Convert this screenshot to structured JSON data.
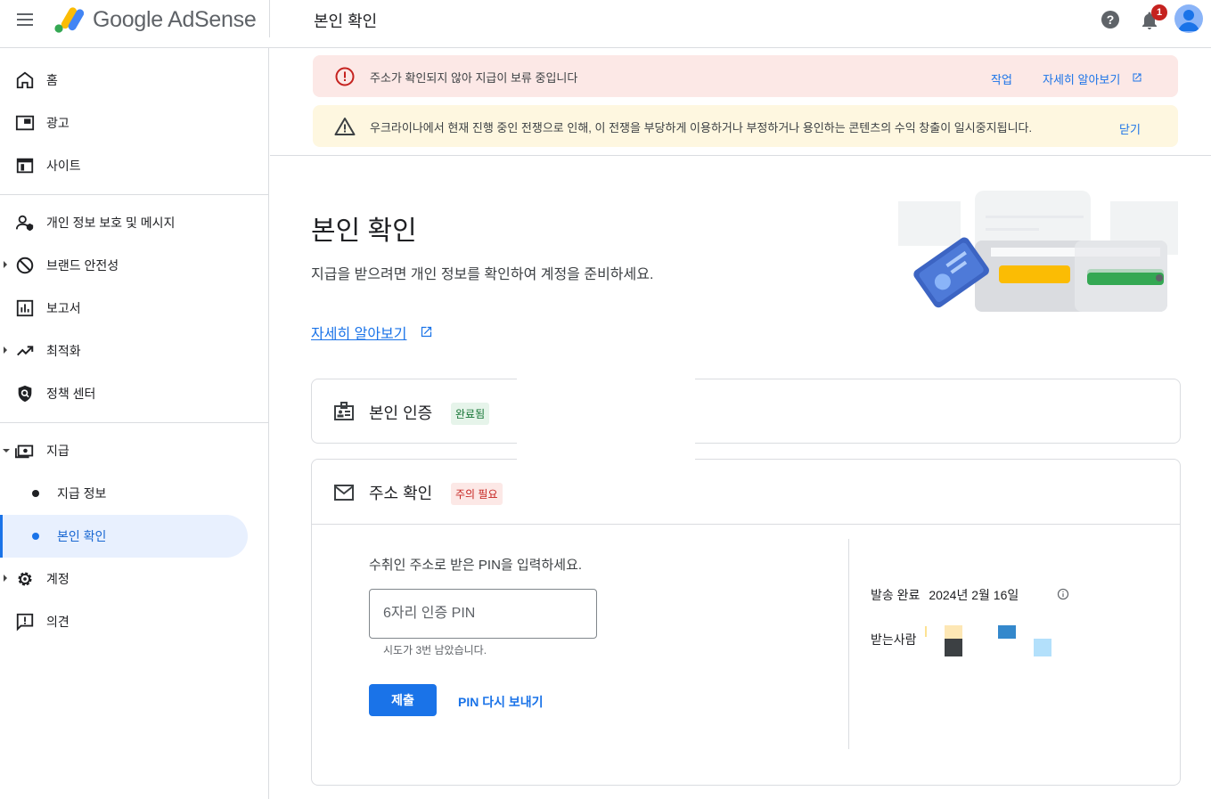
{
  "header": {
    "app_name": "Google AdSense",
    "page_title": "본인 확인",
    "notification_count": "1"
  },
  "sidebar": {
    "items": [
      {
        "label": "홈"
      },
      {
        "label": "광고"
      },
      {
        "label": "사이트"
      },
      {
        "label": "개인 정보 보호 및 메시지"
      },
      {
        "label": "브랜드 안전성"
      },
      {
        "label": "보고서"
      },
      {
        "label": "최적화"
      },
      {
        "label": "정책 센터"
      },
      {
        "label": "지급"
      },
      {
        "label": "지급 정보"
      },
      {
        "label": "본인 확인"
      },
      {
        "label": "계정"
      },
      {
        "label": "의견"
      }
    ]
  },
  "banners": {
    "error": {
      "text": "주소가 확인되지 않아 지급이 보류 중입니다",
      "action": "작업",
      "learn_more": "자세히 알아보기"
    },
    "warning": {
      "text": "우크라이나에서 현재 진행 중인 전쟁으로 인해, 이 전쟁을 부당하게 이용하거나 부정하거나 용인하는 콘텐츠의 수익 창출이 일시중지됩니다.",
      "close": "닫기"
    }
  },
  "main": {
    "title": "본인 확인",
    "description": "지급을 받으려면 개인 정보를 확인하여 계정을 준비하세요.",
    "learn_more": "자세히 알아보기"
  },
  "identity_card": {
    "title": "본인 인증",
    "status": "완료됨"
  },
  "address_card": {
    "title": "주소 확인",
    "status": "주의 필요",
    "pin_prompt": "수취인 주소로 받은 PIN을 입력하세요.",
    "pin_placeholder": "6자리 인증 PIN",
    "attempts_left": "시도가 3번 남았습니다.",
    "submit": "제출",
    "resend": "PIN 다시 보내기",
    "sent_label": "발송 완료",
    "sent_date": "2024년 2월 16일",
    "recipient_label": "받는사람"
  },
  "colors": {
    "primary": "#1a73e8",
    "error_bg": "#fce8e6",
    "error": "#c5221f",
    "warning_bg": "#fef7e0",
    "success_bg": "#e6f4ea",
    "success": "#137333",
    "active_nav_bg": "#e8f0fe"
  }
}
